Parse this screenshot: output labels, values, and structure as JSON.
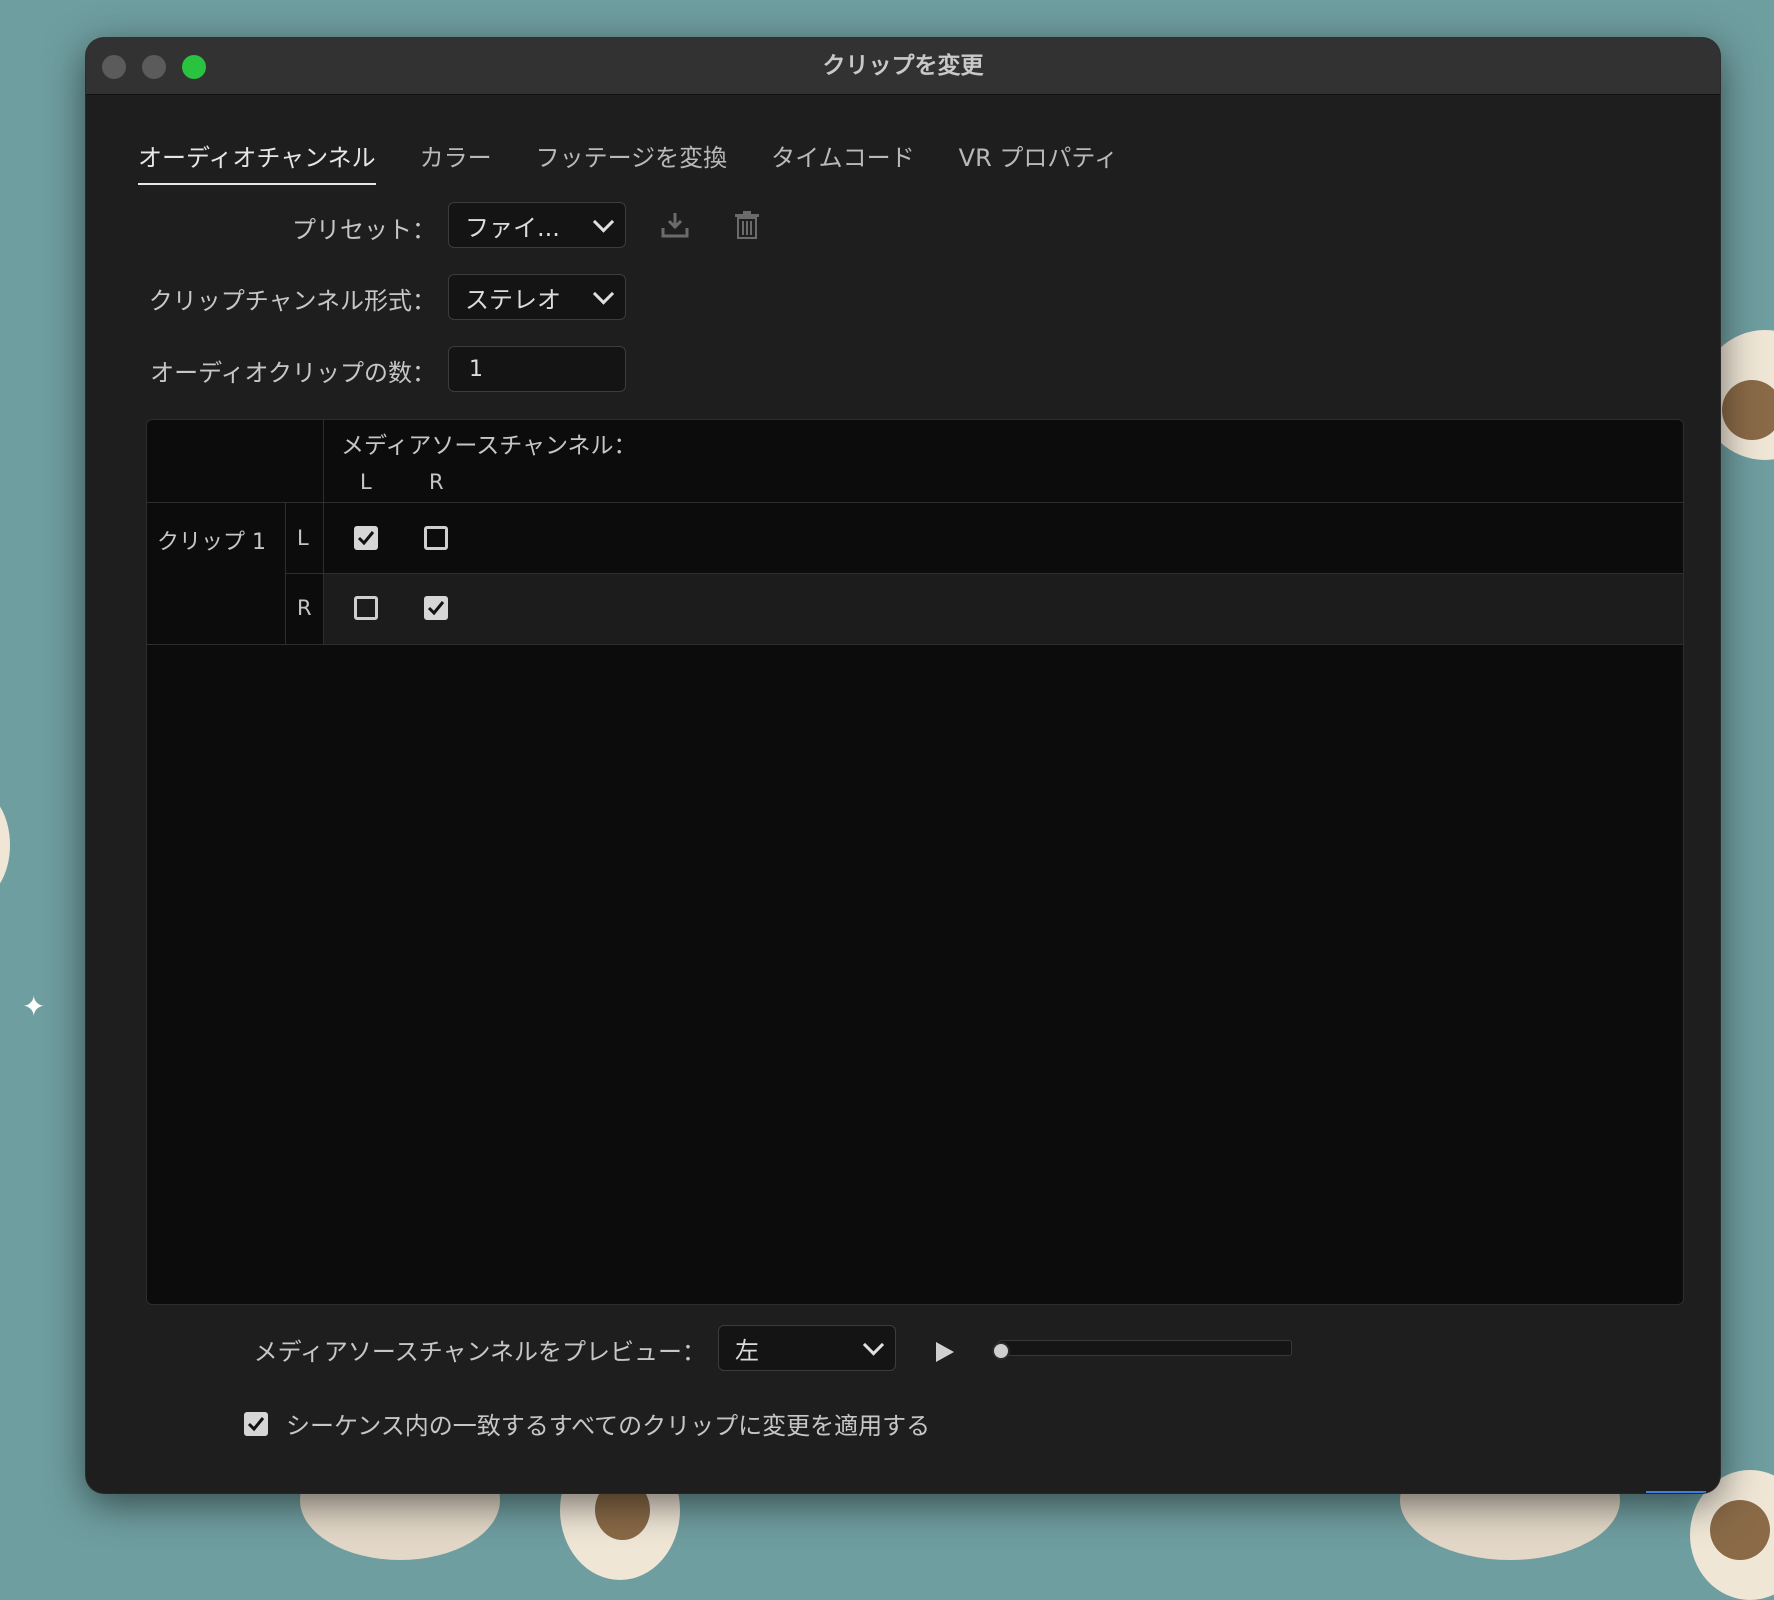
{
  "window": {
    "title": "クリップを変更"
  },
  "tabs": [
    {
      "label": "オーディオチャンネル",
      "active": true
    },
    {
      "label": "カラー",
      "active": false
    },
    {
      "label": "フッテージを変換",
      "active": false
    },
    {
      "label": "タイムコード",
      "active": false
    },
    {
      "label": "VR プロパティ",
      "active": false
    }
  ],
  "preset": {
    "label": "プリセット：",
    "value": "ファイ..."
  },
  "channel_format": {
    "label": "クリップチャンネル形式：",
    "value": "ステレオ"
  },
  "clip_count": {
    "label": "オーディオクリップの数：",
    "value": "1"
  },
  "matrix": {
    "header": "メディアソースチャンネル：",
    "source_channels": [
      "L",
      "R"
    ],
    "clip_label": "クリップ 1",
    "rows": [
      {
        "channel": "L",
        "checked": [
          true,
          false
        ]
      },
      {
        "channel": "R",
        "checked": [
          false,
          true
        ]
      }
    ]
  },
  "preview": {
    "label": "メディアソースチャンネルをプレビュー：",
    "value": "左",
    "progress": 0
  },
  "apply_all": {
    "label": "シーケンス内の一致するすべてのクリップに変更を適用する",
    "checked": true
  },
  "icons": [
    "save-preset-icon",
    "trash-icon",
    "play-icon",
    "chevron-down-icon",
    "checkmark-icon"
  ],
  "colors": {
    "window_bg": "#1e1e1e",
    "panel_bg": "#0c0c0c",
    "text": "#c6c6c6",
    "traffic_green": "#2ac33f"
  }
}
